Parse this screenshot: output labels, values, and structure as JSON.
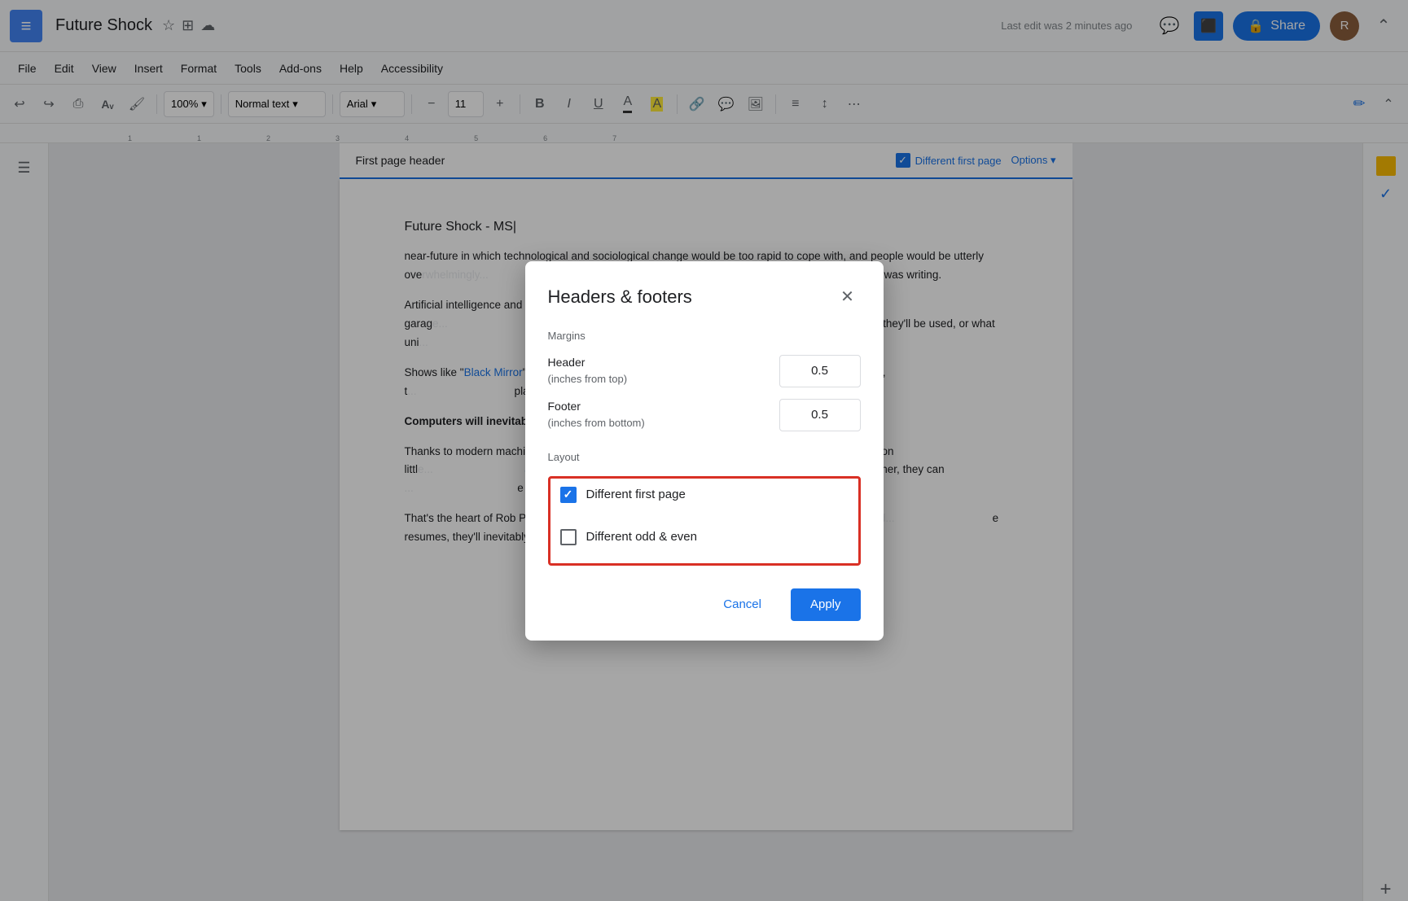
{
  "app": {
    "icon": "≡",
    "title": "Future Shock",
    "star_icon": "☆",
    "move_icon": "⊞",
    "cloud_icon": "☁",
    "last_edit": "Last edit was 2 minutes ago"
  },
  "topbar": {
    "right_icons": [
      "⊟",
      "▼",
      "🔒"
    ],
    "share_label": "Share",
    "avatar_initial": "R"
  },
  "menu": {
    "items": [
      "File",
      "Edit",
      "View",
      "Insert",
      "Format",
      "Tools",
      "Add-ons",
      "Help",
      "Accessibility"
    ]
  },
  "toolbar": {
    "undo": "↩",
    "redo": "↪",
    "print": "⎙",
    "spellcheck": "A",
    "paint": "🖌",
    "zoom": "100%",
    "style": "Normal text",
    "font": "Arial",
    "minus": "−",
    "size": "11",
    "plus": "+",
    "bold": "B",
    "italic": "I",
    "underline": "U",
    "text_color": "A",
    "highlight": "A",
    "link": "🔗",
    "comment": "💬",
    "image": "🖼",
    "align": "≡",
    "spacing": "↕",
    "more": "⋯"
  },
  "header_bar": {
    "title": "First page header",
    "checkbox_label": "Different first page",
    "checkbox_checked": true,
    "options_label": "Options ▾"
  },
  "document": {
    "title": "Future Shock - MS|",
    "paragraphs": [
      "near-future in which technological and sociological change would be too rapid to cope with, and people would be utterly ove...                                          ce of change has accelerated exponentia...                                              Toffler was writing.",
      "Artificial intelligence and ma...                                                                 nodification you can perform in a garag...                                                        e that some technologies are headed to...                                                       dict how they'll be used, or what uni...                                                                 ccur.",
      "Shows like \"Black Mirror\" ro...                                                                    scenarios, but we talked to scientists, t...                                                    plausible applications for emerging te...",
      "Computers will inevitably...",
      "Thanks to modern machine...                                                                       o complete a task often based just on littl...                                              artificial intelligences can already de...                                           aces off against the other, they can ...                                                               e of winning.",
      "That's the heart of Rob Pete...                                                                    at Small Scale AI, and he is concern...                                                       e resumes, they'll inevitably be submitt...                                                        ndidates in the hiring process."
    ],
    "bold_paragraph": "Computers will inevitably..."
  },
  "dialog": {
    "title": "Headers & footers",
    "close_icon": "✕",
    "margins_label": "Margins",
    "header_label": "Header\n(inches from top)",
    "header_value": "0.5",
    "footer_label": "Footer\n(inches from bottom)",
    "footer_value": "0.5",
    "layout_label": "Layout",
    "different_first_page_label": "Different first page",
    "different_first_page_checked": true,
    "different_odd_even_label": "Different odd & even",
    "different_odd_even_checked": false,
    "cancel_label": "Cancel",
    "apply_label": "Apply"
  }
}
